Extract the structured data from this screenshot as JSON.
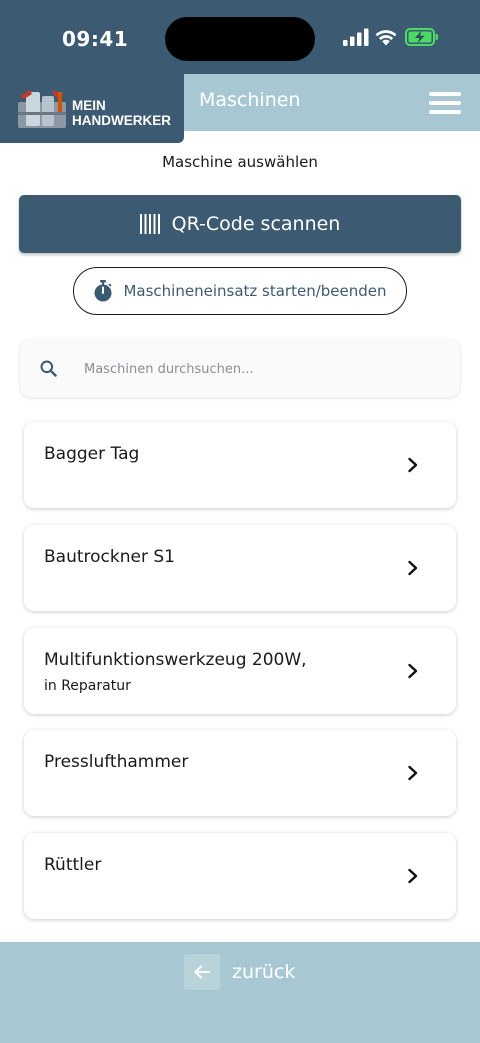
{
  "status_bar": {
    "time": "09:41"
  },
  "header": {
    "logo_line1": "MEIN",
    "logo_line2": "HANDWERKER",
    "title": "Maschinen"
  },
  "page": {
    "subtitle": "Maschine auswählen",
    "qr_label": "QR-Code scannen",
    "timer_label": "Maschineneinsatz starten/beenden",
    "search_placeholder": "Maschinen durchsuchen..."
  },
  "machines": [
    {
      "name": "Bagger Tag",
      "status": ""
    },
    {
      "name": "Bautrockner S1",
      "status": ""
    },
    {
      "name": "Multifunktionswerkzeug 200W,",
      "status": "in Reparatur"
    },
    {
      "name": "Presslufthammer",
      "status": ""
    },
    {
      "name": "Rüttler",
      "status": ""
    }
  ],
  "footer": {
    "back_label": "zurück"
  },
  "colors": {
    "primary": "#3d5a73",
    "secondary": "#a7c8d2",
    "battery": "#4cd964"
  },
  "icons": [
    "signal-icon",
    "wifi-icon",
    "battery-charging-icon",
    "hamburger-menu-icon",
    "barcode-icon",
    "stopwatch-icon",
    "search-icon",
    "chevron-right-icon",
    "arrow-left-icon"
  ]
}
